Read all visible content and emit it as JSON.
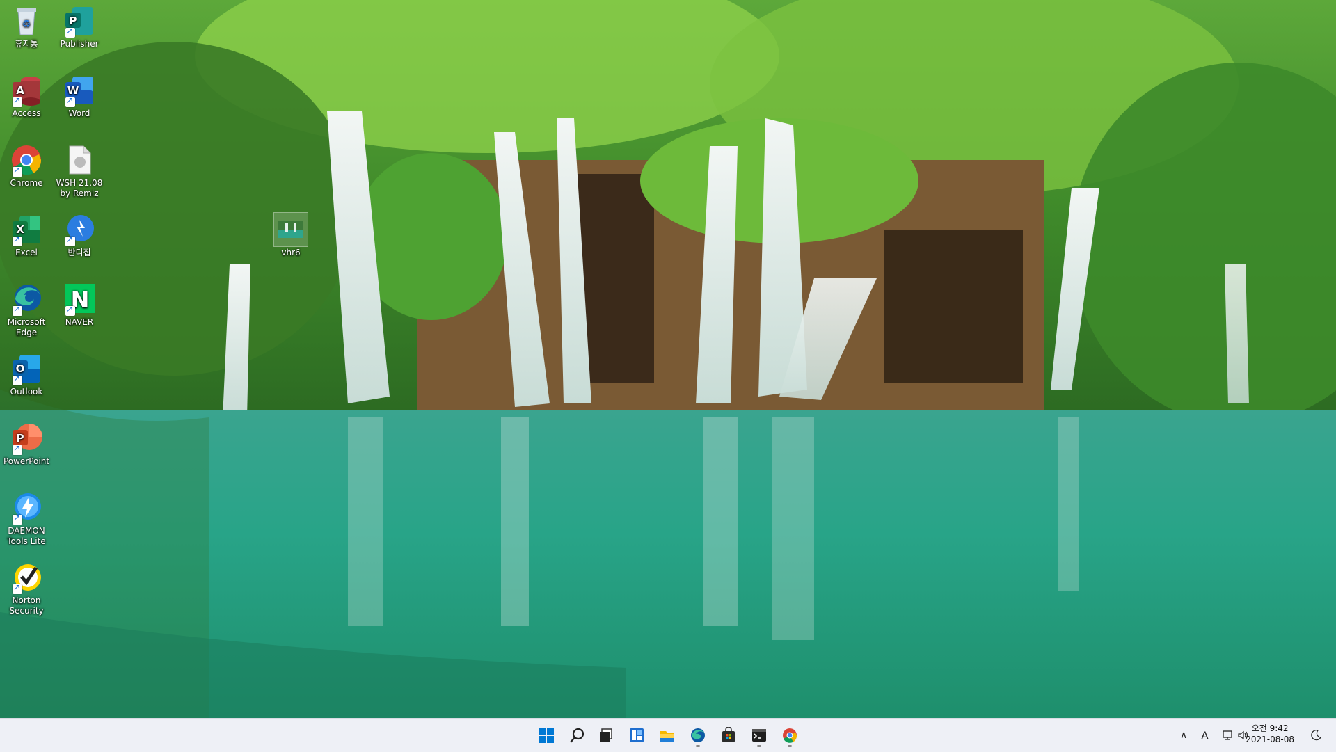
{
  "desktop_icons": [
    {
      "name": "recycle-bin",
      "label": "휴지통",
      "icon": "recycle-bin-icon"
    },
    {
      "name": "publisher",
      "label": "Publisher",
      "icon": "publisher-icon"
    },
    {
      "name": "access",
      "label": "Access",
      "icon": "access-icon"
    },
    {
      "name": "word",
      "label": "Word",
      "icon": "word-icon"
    },
    {
      "name": "chrome",
      "label": "Chrome",
      "icon": "chrome-icon"
    },
    {
      "name": "wsh",
      "label": "WSH 21.08 by Remiz",
      "icon": "wsh-file-icon"
    },
    {
      "name": "excel",
      "label": "Excel",
      "icon": "excel-icon"
    },
    {
      "name": "bandizip",
      "label": "반디집",
      "icon": "bandizip-icon"
    },
    {
      "name": "edge",
      "label": "Microsoft Edge",
      "icon": "edge-icon"
    },
    {
      "name": "naver",
      "label": "NAVER",
      "icon": "naver-icon"
    },
    {
      "name": "outlook",
      "label": "Outlook",
      "icon": "outlook-icon"
    },
    {
      "name": "powerpoint",
      "label": "PowerPoint",
      "icon": "powerpoint-icon"
    },
    {
      "name": "daemon",
      "label": "DAEMON Tools Lite",
      "icon": "daemon-tools-icon"
    },
    {
      "name": "norton",
      "label": "Norton Security",
      "icon": "norton-icon"
    },
    {
      "name": "vhr6",
      "label": "vhr6",
      "icon": "image-file-icon"
    }
  ],
  "taskbar": {
    "apps": [
      "start-icon",
      "search-icon",
      "task-view-icon",
      "widgets-icon",
      "file-explorer-icon",
      "edge-icon",
      "store-icon",
      "terminal-icon",
      "chrome-icon"
    ],
    "tray": {
      "chevron": "∧",
      "ime": "A",
      "time": "오전 9:42",
      "date": "2021-08-08"
    }
  },
  "colors": {
    "taskbar": "#eef0f6",
    "accent": "#0067c0"
  }
}
